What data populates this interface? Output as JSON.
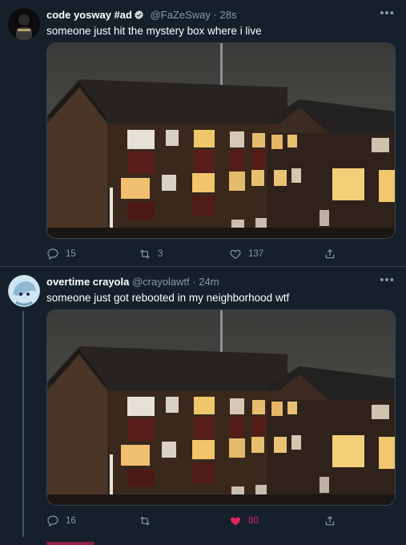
{
  "tweets": [
    {
      "display_name": "code yosway #ad",
      "handle": "@FaZeSway",
      "time": "28s",
      "text": "someone just hit the mystery box where i live",
      "verified": true,
      "more_icon": "more-horizontal-icon",
      "stats": {
        "replies": "15",
        "retweets": "3",
        "likes": "137",
        "reply_icon": "reply-icon",
        "retweet_icon": "retweet-icon",
        "like_icon": "heart-icon",
        "share_icon": "share-icon"
      }
    },
    {
      "display_name": "overtime crayola",
      "handle": "@crayolawtf",
      "time": "24m",
      "text": "someone just got rebooted in my neighborhood wtf",
      "verified": false,
      "more_icon": "more-horizontal-icon",
      "stats": {
        "replies": "16",
        "retweets": "",
        "likes": "80",
        "liked": true,
        "reply_icon": "reply-icon",
        "retweet_icon": "retweet-icon",
        "like_icon": "heart-filled-icon",
        "share_icon": "share-icon"
      }
    }
  ],
  "colors": {
    "background": "#15202b",
    "muted": "#8899a6",
    "like": "#e0245e",
    "verified": "#1da1f2",
    "border": "#38444d"
  },
  "separator": "·"
}
